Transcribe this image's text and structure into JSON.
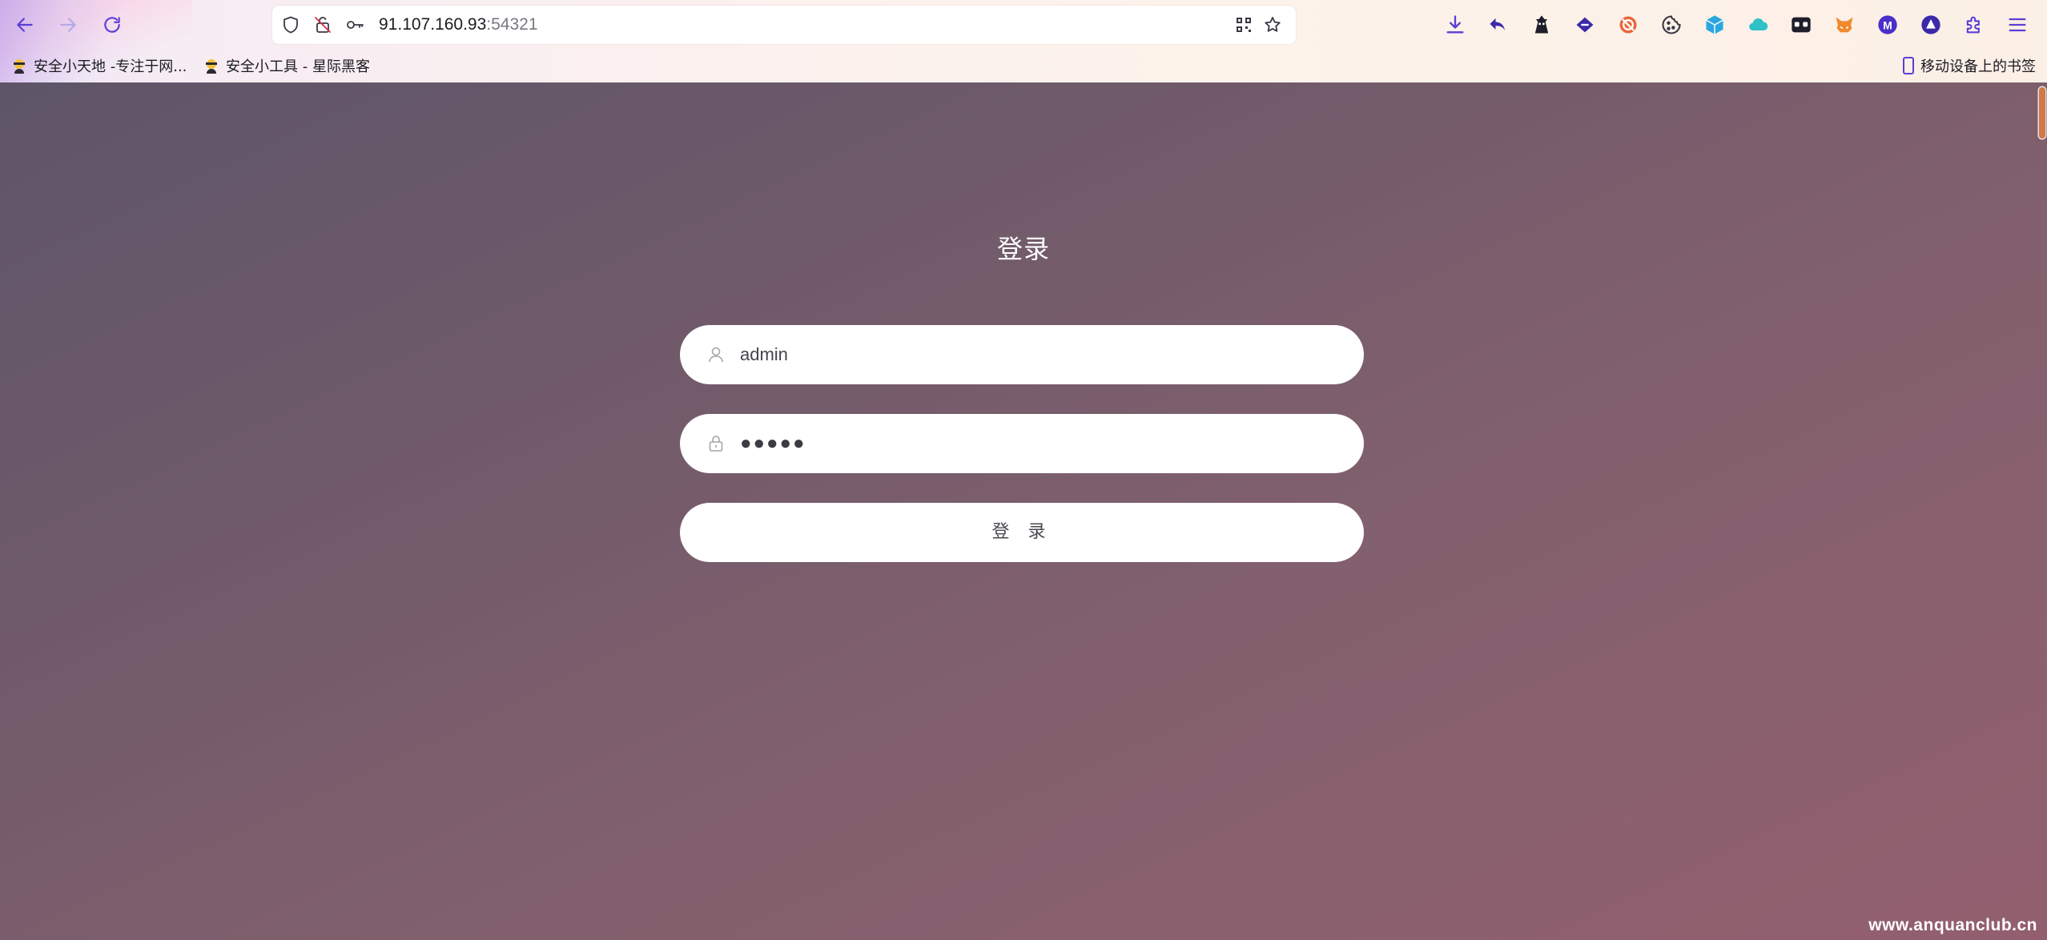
{
  "browser": {
    "url_host": "91.107.160.93",
    "url_port": ":54321",
    "bookmarks": [
      {
        "label": "安全小天地 -专注于网..."
      },
      {
        "label": "安全小工具 - 星际黑客"
      }
    ],
    "mobile_bookmarks_label": "移动设备上的书签"
  },
  "login": {
    "title": "登录",
    "username_value": "admin",
    "password_mask": "●●●●●",
    "submit_label": "登 录"
  },
  "watermark": "www.anquanclub.cn",
  "colors": {
    "accent": "#5b3fd6",
    "page_gradient_start": "#5e5568",
    "page_gradient_end": "#935f6f",
    "field_bg": "#ffffff"
  }
}
